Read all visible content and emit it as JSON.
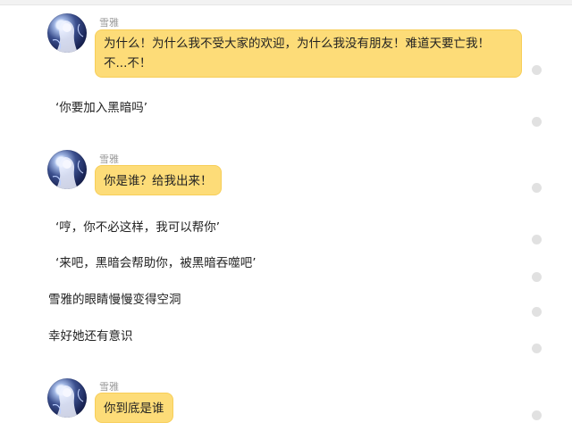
{
  "messages": [
    {
      "speaker": "雪雅",
      "text_line1": "为什么！为什么我不受大家的欢迎，为什么我没有朋友！难道天要亡我！",
      "text_line2": "不...不！"
    },
    {
      "narration": "‘你要加入黑暗吗’"
    },
    {
      "speaker": "雪雅",
      "text": "你是谁？给我出来！"
    },
    {
      "narration": "‘哼，你不必这样，我可以帮你’"
    },
    {
      "narration": "‘来吧，黑暗会帮助你，被黑暗吞噬吧’"
    },
    {
      "narration": "雪雅的眼睛慢慢变得空洞"
    },
    {
      "narration": "幸好她还有意识"
    },
    {
      "speaker": "雪雅",
      "text": "你到底是谁"
    }
  ],
  "colors": {
    "bubble": "#fddc78",
    "bubble_border": "#f7ce58",
    "dot": "#e1e1e1",
    "name": "#9a9a9a"
  },
  "icons": {
    "avatar": "anime-girl-avatar-icon",
    "status_dot": "read-dot-icon"
  }
}
